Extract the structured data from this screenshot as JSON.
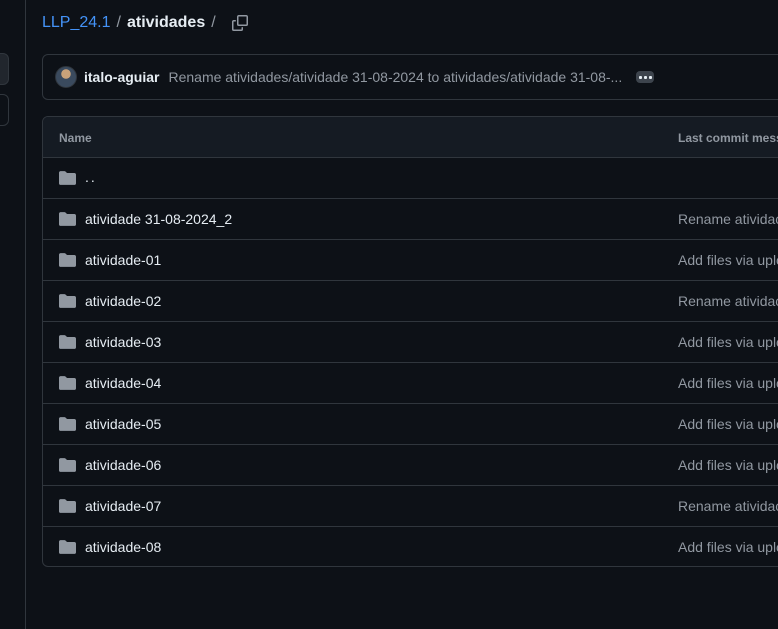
{
  "breadcrumb": {
    "repo": "LLP_24.1",
    "separator": "/",
    "current": "atividades",
    "trailing_separator": "/",
    "copy_icon": "copy-icon"
  },
  "latest_commit": {
    "author": "italo-aguiar",
    "message": "Rename atividades/atividade 31-08-2024 to atividades/atividade 31-08-...",
    "more_icon": "kebab-horizontal-icon"
  },
  "file_table": {
    "columns": {
      "name": "Name",
      "last_commit": "Last commit messa"
    },
    "parent_dir": "..",
    "rows": [
      {
        "name": "atividade 31-08-2024_2",
        "commit": "Rename atividac"
      },
      {
        "name": "atividade-01",
        "commit": "Add files via uplo"
      },
      {
        "name": "atividade-02",
        "commit": "Rename atividac"
      },
      {
        "name": "atividade-03",
        "commit": "Add files via uplo"
      },
      {
        "name": "atividade-04",
        "commit": "Add files via uplo"
      },
      {
        "name": "atividade-05",
        "commit": "Add files via uplo"
      },
      {
        "name": "atividade-06",
        "commit": "Add files via uplo"
      },
      {
        "name": "atividade-07",
        "commit": "Rename atividac"
      },
      {
        "name": "atividade-08",
        "commit": "Add files via uplo"
      }
    ]
  },
  "colors": {
    "background": "#0d1117",
    "border": "#30363d",
    "link": "#4493f8",
    "muted_text": "#9198a1",
    "folder": "#9198a1"
  }
}
